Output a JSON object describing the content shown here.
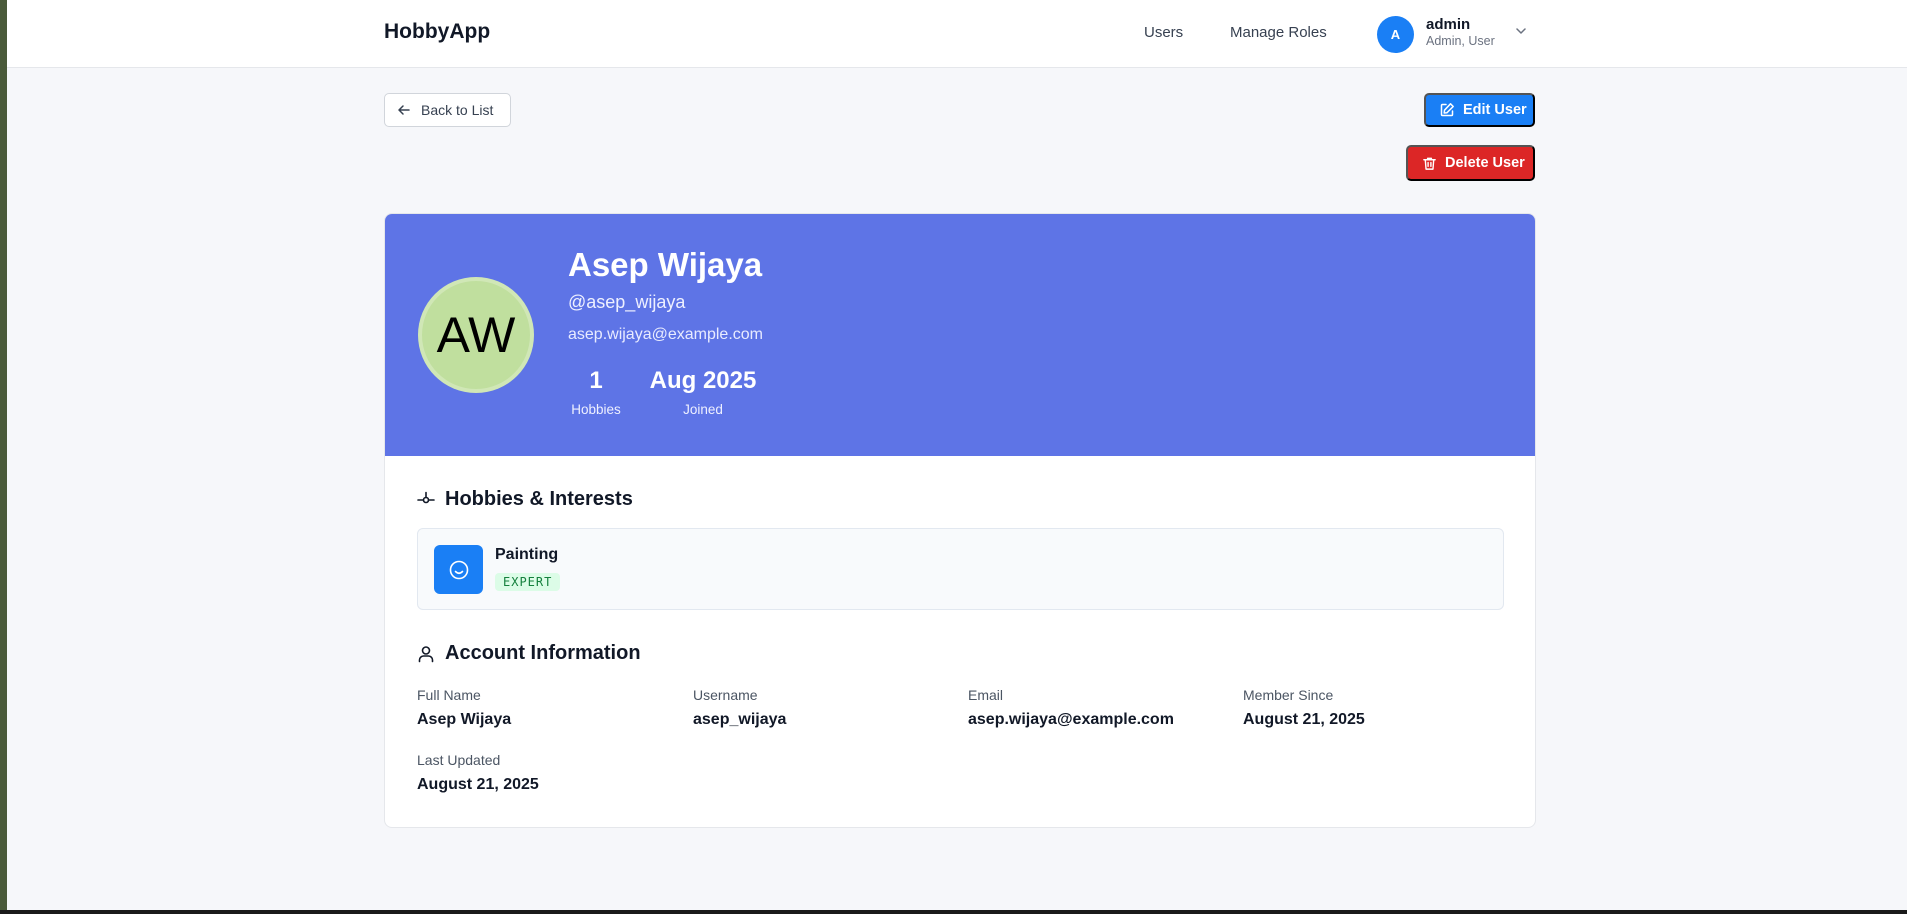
{
  "header": {
    "brand": "HobbyApp",
    "nav": {
      "users": "Users",
      "manage_roles": "Manage Roles"
    },
    "user": {
      "initial": "A",
      "name": "admin",
      "roles": "Admin, User"
    }
  },
  "actions": {
    "back": "Back to List",
    "edit": "Edit User",
    "delete": "Delete User"
  },
  "profile": {
    "initials": "AW",
    "full_name": "Asep Wijaya",
    "handle": "@asep_wijaya",
    "email": "asep.wijaya@example.com",
    "stats": [
      {
        "value": "1",
        "label": "Hobbies"
      },
      {
        "value": "Aug 2025",
        "label": "Joined"
      }
    ],
    "avatar_color": "#c0df9e",
    "hero_color": "#5e74e6"
  },
  "hobbies": {
    "title": "Hobbies & Interests",
    "items": [
      {
        "name": "Painting",
        "level": "EXPERT",
        "icon": "smile-icon"
      }
    ]
  },
  "account": {
    "title": "Account Information",
    "fields": [
      {
        "label": "Full Name",
        "value": "Asep Wijaya"
      },
      {
        "label": "Username",
        "value": "asep_wijaya"
      },
      {
        "label": "Email",
        "value": "asep.wijaya@example.com"
      },
      {
        "label": "Member Since",
        "value": "August 21, 2025"
      },
      {
        "label": "Last Updated",
        "value": "August 21, 2025"
      }
    ]
  },
  "colors": {
    "primary": "#1a7ff5",
    "danger": "#dc2626",
    "badge_bg": "#dcfce7",
    "badge_text": "#15803d"
  }
}
